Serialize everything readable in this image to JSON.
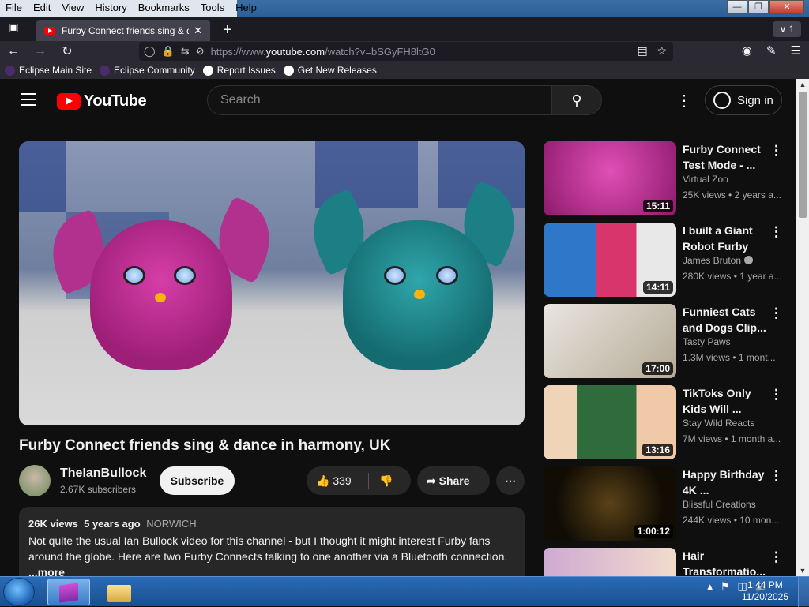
{
  "menu": [
    "File",
    "Edit",
    "View",
    "History",
    "Bookmarks",
    "Tools",
    "Help"
  ],
  "tab": {
    "title": "Furby Connect friends sing & da",
    "count": "1"
  },
  "url": {
    "prefix": "https://www.",
    "domain": "youtube.com",
    "path": "/watch?v=bSGyFH8ltG0"
  },
  "bookmarks": [
    {
      "label": "Eclipse Main Site",
      "color": "#4a2c6d"
    },
    {
      "label": "Eclipse Community",
      "color": "#4a2c6d"
    },
    {
      "label": "Report Issues",
      "color": "#ffffff"
    },
    {
      "label": "Get New Releases",
      "color": "#ffffff"
    }
  ],
  "youtube": {
    "search_placeholder": "Search",
    "signin_label": "Sign in",
    "logo_text": "YouTube"
  },
  "video": {
    "title": "Furby Connect friends sing & dance in harmony, UK",
    "channel": "TheIanBullock",
    "subscribers": "2.67K subscribers",
    "subscribe_label": "Subscribe",
    "likes": "339",
    "share_label": "Share",
    "views": "26K views",
    "age": "5 years ago",
    "location": "NORWICH",
    "description": "Not quite the usual Ian Bullock video for this channel - but I thought it might interest Furby fans around the globe. Here are two Furby Connects talking to one another via a Bluetooth connection.",
    "more_label": "...more"
  },
  "recommendations": [
    {
      "title": "Furby Connect Test Mode - ...",
      "channel": "Virtual Zoo",
      "meta": "25K views • 2 years a...",
      "duration": "15:11",
      "thumb_bg": "#b8278c",
      "verified": false
    },
    {
      "title": "I built a Giant Robot Furby",
      "channel": "James Bruton",
      "meta": "280K views • 1 year a...",
      "duration": "14:11",
      "thumb_bg": "#2f77c9",
      "verified": true
    },
    {
      "title": "Funniest Cats and Dogs Clip...",
      "channel": "Tasty Paws",
      "meta": "1.3M views • 1 mont...",
      "duration": "17:00",
      "thumb_bg": "#c9c3b8",
      "verified": false
    },
    {
      "title": "TikToks Only Kids Will ...",
      "channel": "Stay Wild Reacts",
      "meta": "7M views • 1 month a...",
      "duration": "13:16",
      "thumb_bg": "#3f8a4d",
      "verified": false
    },
    {
      "title": "Happy Birthday 4K ...",
      "channel": "Blissful Creations",
      "meta": "244K views • 10 mon...",
      "duration": "1:00:12",
      "thumb_bg": "#1a1408",
      "verified": false
    },
    {
      "title": "Hair Transformatio...",
      "channel": "",
      "meta": "",
      "duration": "",
      "thumb_bg": "#cfa9d4",
      "verified": false
    }
  ],
  "taskbar": {
    "time": "1:44 PM",
    "date": "11/20/2025"
  }
}
